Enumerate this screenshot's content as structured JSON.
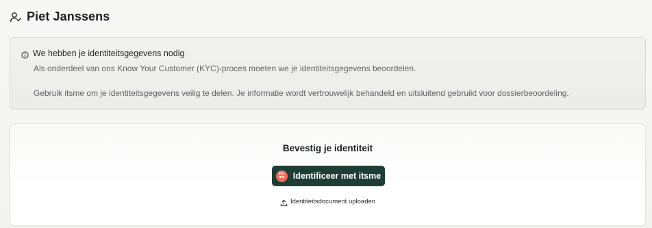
{
  "header": {
    "icon": "person-check-icon",
    "title": "Piet Janssens"
  },
  "info": {
    "icon": "info-circle-icon",
    "title": "We hebben je identiteitsgegevens nodig",
    "paragraph1": "Als onderdeel van ons Know Your Customer (KYC)-proces moeten we je identiteitsgegevens beoordelen.",
    "paragraph2": "Gebruik itsme om je identiteitsgegevens veilig te delen. Je informatie wordt vertrouwelijk behandeld en uitsluitend gebruikt voor dossierbeoordeling."
  },
  "confirm": {
    "title": "Bevestig je identiteit",
    "itsme_button": {
      "label": "Identificeer met itsme",
      "logo_text": "its me",
      "bg_color": "#1e3e35",
      "logo_color": "#ef6b5b"
    },
    "upload": {
      "icon": "upload-icon",
      "label": "Identiteitsdocument uploaden"
    }
  }
}
